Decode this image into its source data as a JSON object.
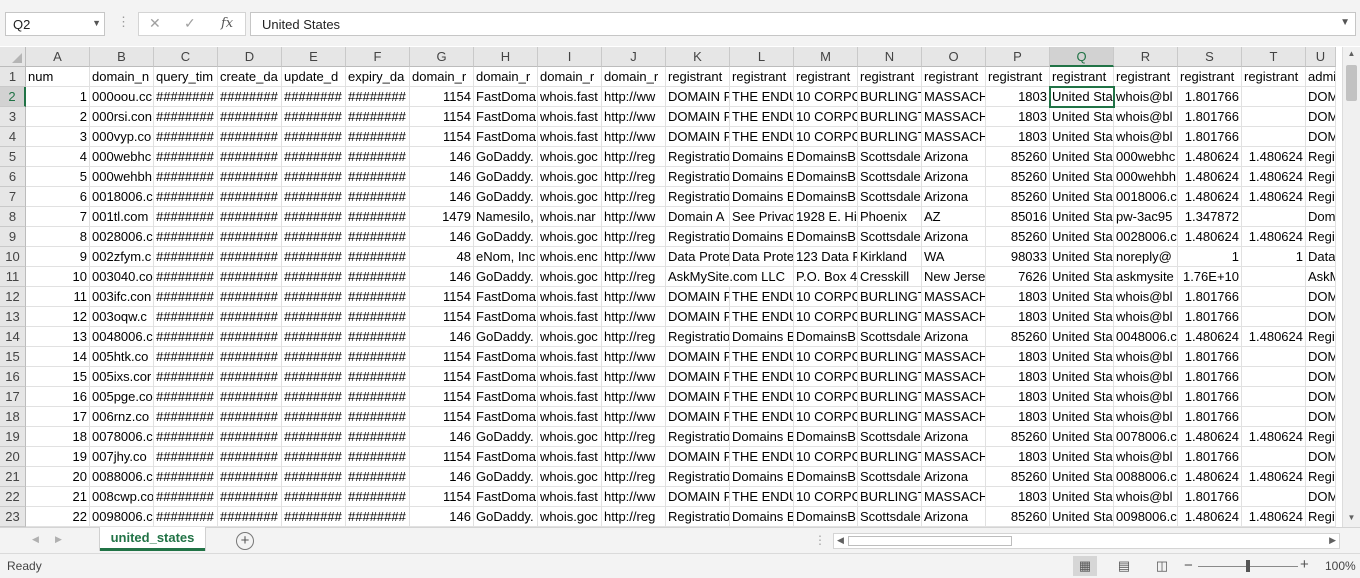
{
  "formula_bar": {
    "name_box": "Q2",
    "dots": "⋮",
    "cancel_glyph": "✕",
    "enter_glyph": "✓",
    "fx_label": "fx",
    "formula_value": "United States",
    "expand_glyph": "⌄"
  },
  "columns": [
    "A",
    "B",
    "C",
    "D",
    "E",
    "F",
    "G",
    "H",
    "I",
    "J",
    "K",
    "L",
    "M",
    "N",
    "O",
    "P",
    "Q",
    "R",
    "S",
    "T",
    "U"
  ],
  "row_numbers": [
    "1",
    "2",
    "3",
    "4",
    "5",
    "6",
    "7",
    "8",
    "9",
    "10",
    "11",
    "12",
    "13",
    "14",
    "15",
    "16",
    "17",
    "18",
    "19",
    "20",
    "21",
    "22",
    "23"
  ],
  "active_cell": {
    "row": 2,
    "col": "Q"
  },
  "rows": [
    [
      "num",
      "domain_n",
      "query_tim",
      "create_da",
      "update_d",
      "expiry_da",
      "domain_r",
      "domain_r",
      "domain_r",
      "domain_r",
      "registrant",
      "registrant",
      "registrant",
      "registrant",
      "registrant",
      "registrant",
      "registrant",
      "registrant",
      "registrant",
      "registrant",
      "admi"
    ],
    [
      "1",
      "000oou.cc",
      "########",
      "########",
      "########",
      "########",
      "1154",
      "FastDoma",
      "whois.fast",
      "http://ww",
      "DOMAIN P",
      "THE ENDU",
      "10 CORPO",
      "BURLINGT",
      "MASSACH",
      "1803",
      "United Sta",
      "whois@bl",
      "1.801766",
      "",
      "DOM"
    ],
    [
      "2",
      "000rsi.con",
      "########",
      "########",
      "########",
      "########",
      "1154",
      "FastDoma",
      "whois.fast",
      "http://ww",
      "DOMAIN P",
      "THE ENDU",
      "10 CORPO",
      "BURLINGT",
      "MASSACH",
      "1803",
      "United Sta",
      "whois@bl",
      "1.801766",
      "",
      "DOM"
    ],
    [
      "3",
      "000vyp.co",
      "########",
      "########",
      "########",
      "########",
      "1154",
      "FastDoma",
      "whois.fast",
      "http://ww",
      "DOMAIN P",
      "THE ENDU",
      "10 CORPO",
      "BURLINGT",
      "MASSACH",
      "1803",
      "United Sta",
      "whois@bl",
      "1.801766",
      "",
      "DOM"
    ],
    [
      "4",
      "000webhc",
      "########",
      "########",
      "########",
      "########",
      "146",
      "GoDaddy.",
      "whois.goc",
      "http://reg",
      "Registratio",
      "Domains B",
      "DomainsB",
      "Scottsdale",
      "Arizona",
      "85260",
      "United Sta",
      "000webhc",
      "1.480624",
      "1.480624",
      "Regis"
    ],
    [
      "5",
      "000wehbh",
      "########",
      "########",
      "########",
      "########",
      "146",
      "GoDaddy.",
      "whois.goc",
      "http://reg",
      "Registratio",
      "Domains B",
      "DomainsB",
      "Scottsdale",
      "Arizona",
      "85260",
      "United Sta",
      "000wehbh",
      "1.480624",
      "1.480624",
      "Regis"
    ],
    [
      "6",
      "0018006.c",
      "########",
      "########",
      "########",
      "########",
      "146",
      "GoDaddy.",
      "whois.goc",
      "http://reg",
      "Registratio",
      "Domains B",
      "DomainsB",
      "Scottsdale",
      "Arizona",
      "85260",
      "United Sta",
      "0018006.c",
      "1.480624",
      "1.480624",
      "Regis"
    ],
    [
      "7",
      "001tl.com",
      "########",
      "########",
      "########",
      "########",
      "1479",
      "Namesilo,",
      "whois.nar",
      "http://ww",
      "Domain A",
      "See Privac",
      "1928 E. Hig",
      "Phoenix",
      "AZ",
      "85016",
      "United Sta",
      "pw-3ac95",
      "1.347872",
      "",
      "Dom"
    ],
    [
      "8",
      "0028006.c",
      "########",
      "########",
      "########",
      "########",
      "146",
      "GoDaddy.",
      "whois.goc",
      "http://reg",
      "Registratio",
      "Domains B",
      "DomainsB",
      "Scottsdale",
      "Arizona",
      "85260",
      "United Sta",
      "0028006.c",
      "1.480624",
      "1.480624",
      "Regis"
    ],
    [
      "9",
      "002zfym.c",
      "########",
      "########",
      "########",
      "########",
      "48",
      "eNom, Inc",
      "whois.enc",
      "http://ww",
      "Data Prote",
      "Data Prote",
      "123 Data F",
      "Kirkland",
      "WA",
      "98033",
      "United Sta",
      "noreply@",
      "1",
      "1",
      "Data"
    ],
    [
      "10",
      "003040.co",
      "########",
      "########",
      "########",
      "########",
      "146",
      "GoDaddy.",
      "whois.goc",
      "http://reg",
      "AskMySite.com LLC",
      "",
      "P.O. Box 4",
      "Cresskill",
      "New Jerse",
      "7626",
      "United Sta",
      "askmysite",
      "1.76E+10",
      "",
      "AskM"
    ],
    [
      "11",
      "003ifc.con",
      "########",
      "########",
      "########",
      "########",
      "1154",
      "FastDoma",
      "whois.fast",
      "http://ww",
      "DOMAIN P",
      "THE ENDU",
      "10 CORPO",
      "BURLINGT",
      "MASSACH",
      "1803",
      "United Sta",
      "whois@bl",
      "1.801766",
      "",
      "DOM"
    ],
    [
      "12",
      "003oqw.c",
      "########",
      "########",
      "########",
      "########",
      "1154",
      "FastDoma",
      "whois.fast",
      "http://ww",
      "DOMAIN P",
      "THE ENDU",
      "10 CORPO",
      "BURLINGT",
      "MASSACH",
      "1803",
      "United Sta",
      "whois@bl",
      "1.801766",
      "",
      "DOM"
    ],
    [
      "13",
      "0048006.c",
      "########",
      "########",
      "########",
      "########",
      "146",
      "GoDaddy.",
      "whois.goc",
      "http://reg",
      "Registratio",
      "Domains B",
      "DomainsB",
      "Scottsdale",
      "Arizona",
      "85260",
      "United Sta",
      "0048006.c",
      "1.480624",
      "1.480624",
      "Regis"
    ],
    [
      "14",
      "005htk.co",
      "########",
      "########",
      "########",
      "########",
      "1154",
      "FastDoma",
      "whois.fast",
      "http://ww",
      "DOMAIN P",
      "THE ENDU",
      "10 CORPO",
      "BURLINGT",
      "MASSACH",
      "1803",
      "United Sta",
      "whois@bl",
      "1.801766",
      "",
      "DOM"
    ],
    [
      "15",
      "005ixs.cor",
      "########",
      "########",
      "########",
      "########",
      "1154",
      "FastDoma",
      "whois.fast",
      "http://ww",
      "DOMAIN P",
      "THE ENDU",
      "10 CORPO",
      "BURLINGT",
      "MASSACH",
      "1803",
      "United Sta",
      "whois@bl",
      "1.801766",
      "",
      "DOM"
    ],
    [
      "16",
      "005pge.co",
      "########",
      "########",
      "########",
      "########",
      "1154",
      "FastDoma",
      "whois.fast",
      "http://ww",
      "DOMAIN P",
      "THE ENDU",
      "10 CORPO",
      "BURLINGT",
      "MASSACH",
      "1803",
      "United Sta",
      "whois@bl",
      "1.801766",
      "",
      "DOM"
    ],
    [
      "17",
      "006rnz.co",
      "########",
      "########",
      "########",
      "########",
      "1154",
      "FastDoma",
      "whois.fast",
      "http://ww",
      "DOMAIN P",
      "THE ENDU",
      "10 CORPO",
      "BURLINGT",
      "MASSACH",
      "1803",
      "United Sta",
      "whois@bl",
      "1.801766",
      "",
      "DOM"
    ],
    [
      "18",
      "0078006.c",
      "########",
      "########",
      "########",
      "########",
      "146",
      "GoDaddy.",
      "whois.goc",
      "http://reg",
      "Registratio",
      "Domains B",
      "DomainsB",
      "Scottsdale",
      "Arizona",
      "85260",
      "United Sta",
      "0078006.c",
      "1.480624",
      "1.480624",
      "Regis"
    ],
    [
      "19",
      "007jhy.co",
      "########",
      "########",
      "########",
      "########",
      "1154",
      "FastDoma",
      "whois.fast",
      "http://ww",
      "DOMAIN P",
      "THE ENDU",
      "10 CORPO",
      "BURLINGT",
      "MASSACH",
      "1803",
      "United Sta",
      "whois@bl",
      "1.801766",
      "",
      "DOM"
    ],
    [
      "20",
      "0088006.c",
      "########",
      "########",
      "########",
      "########",
      "146",
      "GoDaddy.",
      "whois.goc",
      "http://reg",
      "Registratio",
      "Domains B",
      "DomainsB",
      "Scottsdale",
      "Arizona",
      "85260",
      "United Sta",
      "0088006.c",
      "1.480624",
      "1.480624",
      "Regis"
    ],
    [
      "21",
      "008cwp.co",
      "########",
      "########",
      "########",
      "########",
      "1154",
      "FastDoma",
      "whois.fast",
      "http://ww",
      "DOMAIN P",
      "THE ENDU",
      "10 CORPO",
      "BURLINGT",
      "MASSACH",
      "1803",
      "United Sta",
      "whois@bl",
      "1.801766",
      "",
      "DOM"
    ],
    [
      "22",
      "0098006.c",
      "########",
      "########",
      "########",
      "########",
      "146",
      "GoDaddy.",
      "whois.goc",
      "http://reg",
      "Registratio",
      "Domains B",
      "DomainsB",
      "Scottsdale",
      "Arizona",
      "85260",
      "United Sta",
      "0098006.c",
      "1.480624",
      "1.480624",
      "Regis"
    ]
  ],
  "numeric_columns": [
    "A",
    "G",
    "P",
    "S",
    "T"
  ],
  "sheet_tabs": {
    "prev_glyph": "◀",
    "next_glyph": "▶",
    "active_tab": "united_states",
    "add_glyph": "+"
  },
  "status_bar": {
    "status": "Ready",
    "zoom_minus": "−",
    "zoom_plus": "+",
    "zoom": "100%",
    "zoom_fraction": 0.5
  },
  "colors": {
    "accent": "#217346",
    "header_bg": "#e6e6e6",
    "gridline": "#e1e1e1"
  }
}
